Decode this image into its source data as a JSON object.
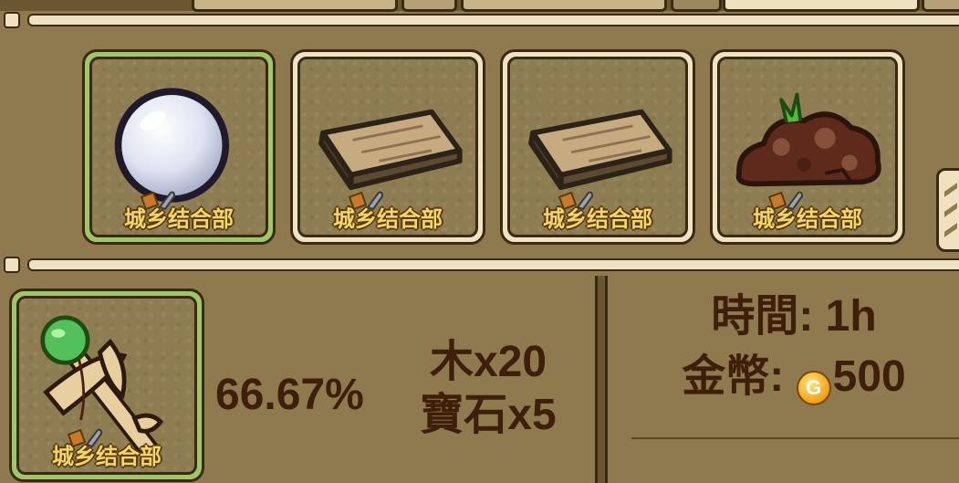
{
  "watermark": "城乡结合部",
  "materials": [
    {
      "name": "pearl-orb",
      "selected": true
    },
    {
      "name": "wood-plank",
      "selected": false
    },
    {
      "name": "wood-plank",
      "selected": false
    },
    {
      "name": "soil-pile",
      "selected": false
    }
  ],
  "product": {
    "icon": "kendama-icon",
    "success_rate": "66.67%",
    "requirements": [
      "木x20",
      "寶石x5"
    ]
  },
  "info": {
    "time": "時間: 1h",
    "gold_label": "金幣:",
    "gold_value": "500",
    "coin_glyph": "G"
  },
  "colors": {
    "background": "#8e7a4e",
    "text": "#3d1f0a",
    "selected_border": "#9ec867",
    "slot_border": "#f0e4c4"
  }
}
